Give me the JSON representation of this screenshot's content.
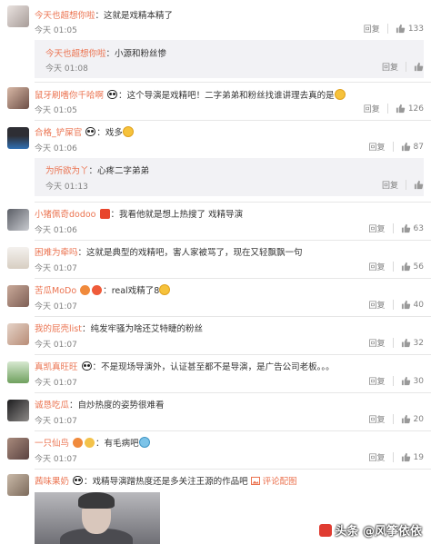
{
  "ui": {
    "reply_label": "回复",
    "separator": "："
  },
  "comments": [
    {
      "user": "今天也超想你啦",
      "text": "这就是戏精本精了",
      "time": "今天 01:05",
      "likes": "133"
    },
    {
      "user": "今天也超想你啦",
      "text": "小源和粉丝惨",
      "time": "今天 01:08"
    },
    {
      "user": "鼠牙刷嗜你千哈啊",
      "text": "这个导演是戏精吧！二字弟弟和粉丝找谁讲理去真的是",
      "time": "今天 01:05",
      "likes": "126"
    },
    {
      "user": "合格_铲屎官",
      "text": "戏多",
      "time": "今天 01:06",
      "likes": "87"
    },
    {
      "user": "为所欲为丫",
      "text": "心疼二字弟弟",
      "time": "今天 01:13"
    },
    {
      "user": "小猪佩奇dodoo",
      "text": "我看他就是想上热搜了 戏精导演",
      "time": "今天 01:06",
      "likes": "63"
    },
    {
      "user": "困难为牵吗",
      "text": "这就是典型的戏精吧，害人家被骂了，现在又轻飘飘一句",
      "time": "今天 01:07",
      "likes": "56"
    },
    {
      "user": "苦瓜MoDo",
      "text": "real戏精了8",
      "time": "今天 01:07",
      "likes": "40"
    },
    {
      "user": "我的屁壳list",
      "text": "纯发牢骚为啥还艾特睫的粉丝",
      "time": "今天 01:07",
      "likes": "32"
    },
    {
      "user": "真凯真旺旺",
      "text": "不是现场导演外，认证甚至都不是导演，是广告公司老板。。。",
      "time": "今天 01:07",
      "likes": "30"
    },
    {
      "user": "诚恳吃瓜",
      "text": "自炒热度的姿势很难看",
      "time": "今天 01:07",
      "likes": "20"
    },
    {
      "user": "一只仙鸟",
      "text": "有毛病吧",
      "time": "今天 01:07",
      "likes": "19"
    },
    {
      "user": "茜味果奶",
      "text": "戏精导演蹭热度还是多关注王源的作品吧",
      "link": "评论配图"
    }
  ],
  "watermark": "头条 @风筝依依",
  "colors": {
    "username": "#eb7350",
    "text": "#333333",
    "muted": "#808080",
    "reply_bg": "#f2f2f5"
  }
}
